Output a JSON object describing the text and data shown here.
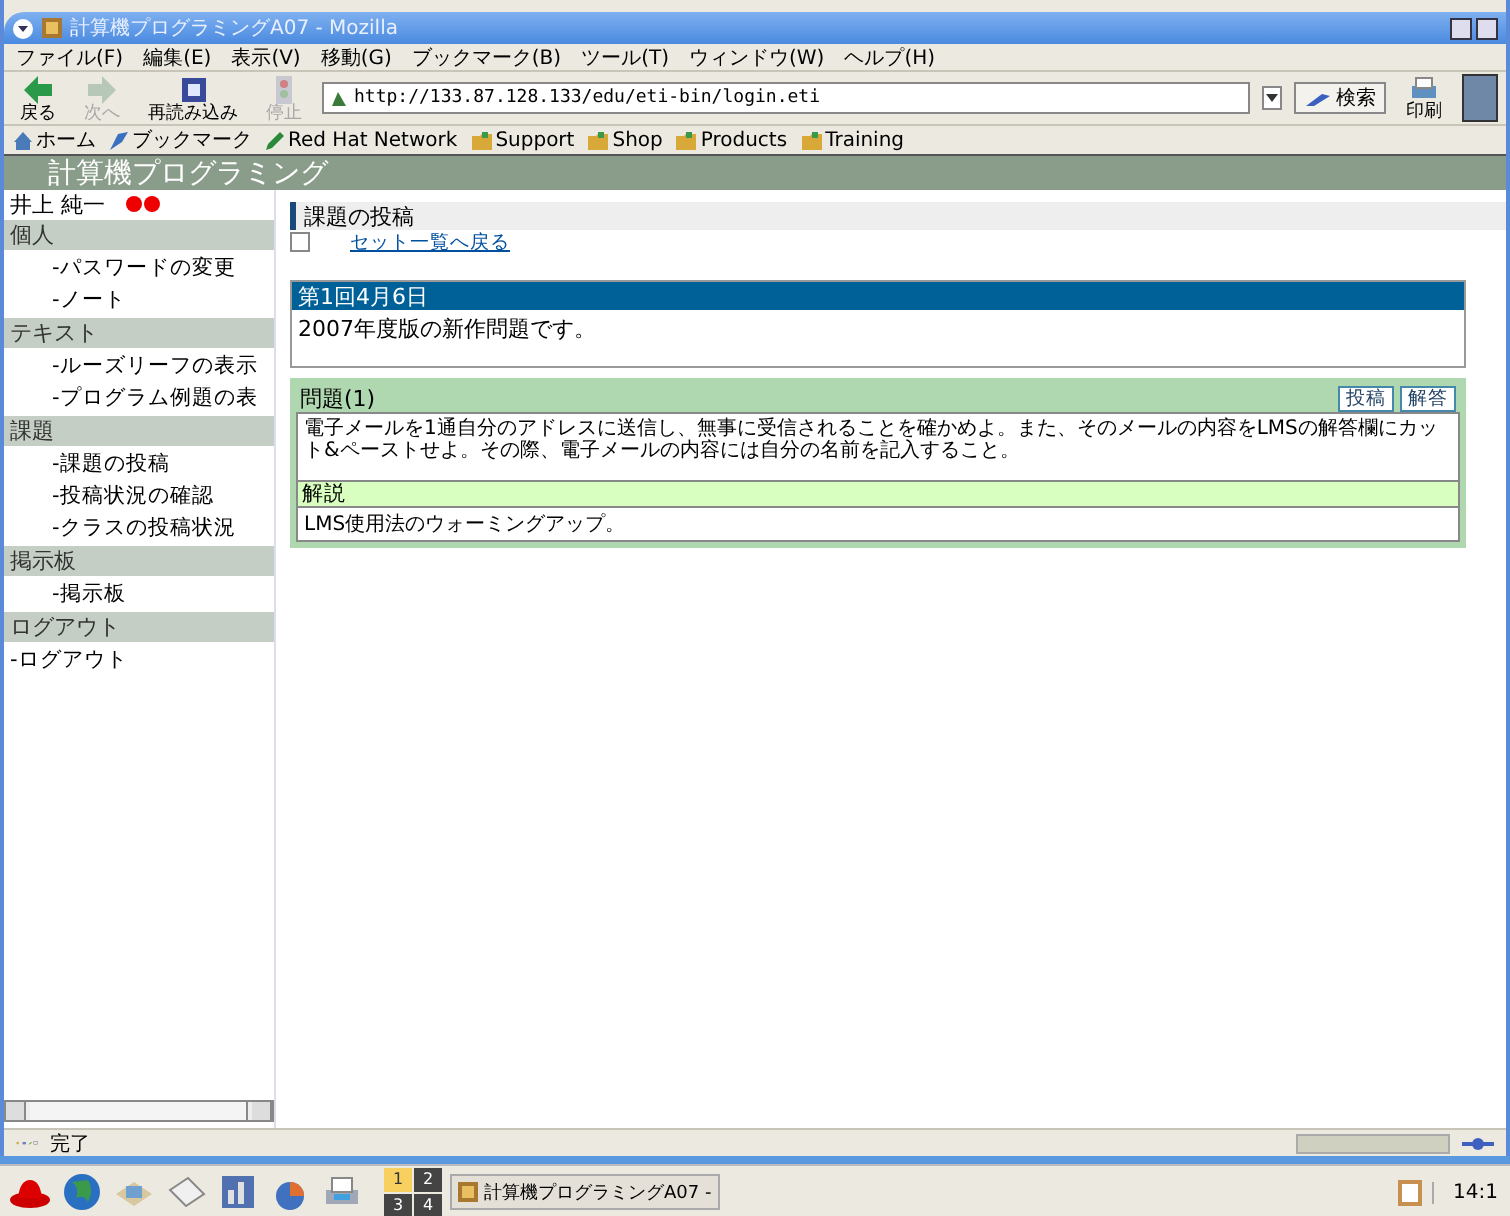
{
  "window": {
    "title": "計算機プログラミングA07 - Mozilla"
  },
  "menu": [
    "ファイル(F)",
    "編集(E)",
    "表示(V)",
    "移動(G)",
    "ブックマーク(B)",
    "ツール(T)",
    "ウィンドウ(W)",
    "ヘルプ(H)"
  ],
  "toolbar": {
    "buttons": [
      {
        "label": "戻る",
        "kind": "back",
        "disabled": false
      },
      {
        "label": "次へ",
        "kind": "forward",
        "disabled": true
      },
      {
        "label": "再読み込み",
        "kind": "reload",
        "disabled": false
      },
      {
        "label": "停止",
        "kind": "stop",
        "disabled": true
      }
    ],
    "url": "http://133.87.128.133/edu/eti-bin/login.eti",
    "search": "検索",
    "print": "印刷"
  },
  "bookmarks": [
    {
      "label": "ホーム",
      "kind": "home"
    },
    {
      "label": "ブックマーク",
      "kind": "bookmarks"
    },
    {
      "label": "Red Hat Network",
      "kind": "pen"
    },
    {
      "label": "Support",
      "kind": "folder"
    },
    {
      "label": "Shop",
      "kind": "folder"
    },
    {
      "label": "Products",
      "kind": "folder"
    },
    {
      "label": "Training",
      "kind": "folder"
    }
  ],
  "site": {
    "title": "計算機プログラミング"
  },
  "sidebar": {
    "user": "井上 純一",
    "sections": [
      {
        "header": "個人",
        "items": [
          "-パスワードの変更",
          "-ノート"
        ]
      },
      {
        "header": "テキスト",
        "items": [
          "-ルーズリーフの表示",
          "-プログラム例題の表"
        ]
      },
      {
        "header": "課題",
        "items": [
          "-課題の投稿",
          "-投稿状況の確認",
          "-クラスの投稿状況"
        ]
      },
      {
        "header": "掲示板",
        "items": [
          "-掲示板"
        ]
      },
      {
        "header": "ログアウト",
        "items": [
          "-ログアウト"
        ]
      }
    ]
  },
  "main": {
    "heading": "課題の投稿",
    "back_link": "セット一覧へ戻る",
    "session": {
      "title": "第1回4月6日",
      "text": "2007年度版の新作問題です。"
    },
    "problem": {
      "title": "問題(1)",
      "buttons": [
        "投稿",
        "解答"
      ],
      "text": "電子メールを1通自分のアドレスに送信し、無事に受信されることを確かめよ。また、そのメールの内容をLMSの解答欄にカット&ペーストせよ。その際、電子メールの内容には自分の名前を記入すること。",
      "note_title": "解説",
      "note": "LMS使用法のウォーミングアップ。"
    }
  },
  "status_bar": {
    "text": "完了",
    "progress": {
      "level": 0
    }
  },
  "taskbar": {
    "workspaces": [
      {
        "label": "1",
        "selected": true
      },
      {
        "label": "2",
        "selected": false
      },
      {
        "label": "3",
        "selected": false
      },
      {
        "label": "4",
        "selected": false
      }
    ],
    "task": "計算機プログラミングA07 -",
    "clock": "14:1"
  }
}
